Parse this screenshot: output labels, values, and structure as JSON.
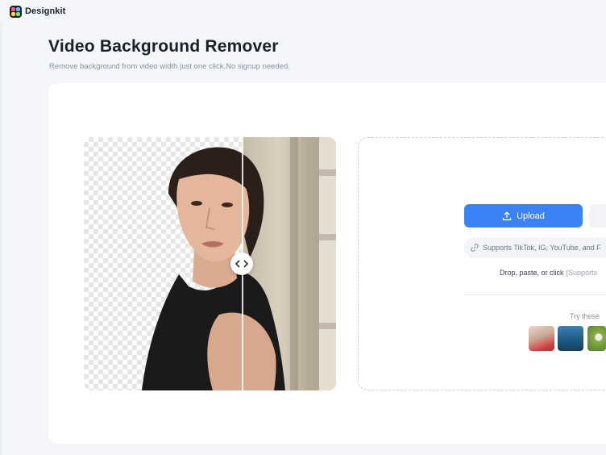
{
  "header": {
    "brand_name": "Designkit"
  },
  "page": {
    "title": "Video Background Remover",
    "subtitle": "Remove background from video width just one click.No signup needed."
  },
  "preview": {
    "handle_icon": "compare-arrows-icon"
  },
  "upload": {
    "upload_label": "Upload",
    "url_placeholder": "Supports TikTok, IG, YouTube, and F",
    "drop_hint": "Drop, paste, or click",
    "drop_hint_extra": "(Supports",
    "try_label": "Try these"
  },
  "colors": {
    "accent": "#3b82f6",
    "background": "#f4f6fa",
    "card": "#ffffff"
  }
}
